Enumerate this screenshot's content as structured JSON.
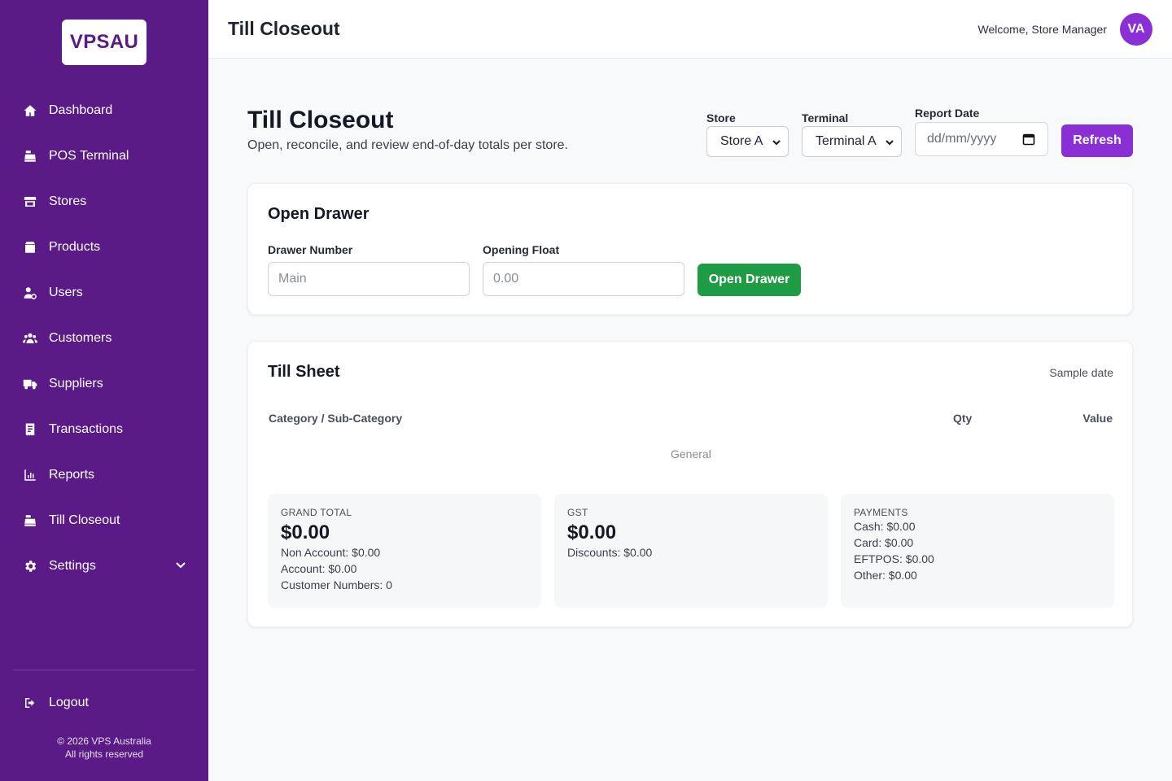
{
  "brand": {
    "logo_text": "VPSAU"
  },
  "sidebar": {
    "items": [
      {
        "label": "Dashboard",
        "icon": "home-icon"
      },
      {
        "label": "POS Terminal",
        "icon": "cash-register-icon"
      },
      {
        "label": "Stores",
        "icon": "store-icon"
      },
      {
        "label": "Products",
        "icon": "box-icon"
      },
      {
        "label": "Users",
        "icon": "user-gear-icon"
      },
      {
        "label": "Customers",
        "icon": "users-icon"
      },
      {
        "label": "Suppliers",
        "icon": "truck-icon"
      },
      {
        "label": "Transactions",
        "icon": "receipt-icon"
      },
      {
        "label": "Reports",
        "icon": "chart-icon"
      },
      {
        "label": "Till Closeout",
        "icon": "cash-register-icon"
      },
      {
        "label": "Settings",
        "icon": "gear-icon"
      }
    ],
    "logout": "Logout",
    "footer_line1": "© 2026 VPS Australia",
    "footer_line2": "All rights reserved"
  },
  "topbar": {
    "title": "Till Closeout",
    "welcome": "Welcome, Store Manager",
    "avatar_initials": "VA"
  },
  "page": {
    "title": "Till Closeout",
    "subtitle": "Open, reconcile, and review end-of-day totals per store."
  },
  "filters": {
    "store_label": "Store",
    "store_value": "Store A",
    "terminal_label": "Terminal",
    "terminal_value": "Terminal A",
    "date_label": "Report Date",
    "date_placeholder": "dd/mm/yyyy",
    "refresh_label": "Refresh"
  },
  "open_drawer": {
    "title": "Open Drawer",
    "drawer_label": "Drawer Number",
    "drawer_placeholder": "Main",
    "float_label": "Opening Float",
    "float_placeholder": "0.00",
    "button_label": "Open Drawer"
  },
  "till_sheet": {
    "title": "Till Sheet",
    "date_note": "Sample date",
    "columns": [
      "Category / Sub-Category",
      "Qty",
      "Value"
    ],
    "group_label": "General",
    "grand_total": {
      "caption": "GRAND TOTAL",
      "amount": "$0.00",
      "lines": [
        "Non Account: $0.00",
        "Account: $0.00",
        "Customer Numbers: 0"
      ]
    },
    "gst": {
      "caption": "GST",
      "amount": "$0.00",
      "lines": [
        "Discounts: $0.00"
      ]
    },
    "payments": {
      "caption": "PAYMENTS",
      "lines": [
        "Cash: $0.00",
        "Card: $0.00",
        "EFTPOS: $0.00",
        "Other: $0.00"
      ]
    }
  },
  "colors": {
    "sidebar_bg": "#5b1b86",
    "accent_purple": "#8a2fd6",
    "success_green": "#1f9a45"
  }
}
